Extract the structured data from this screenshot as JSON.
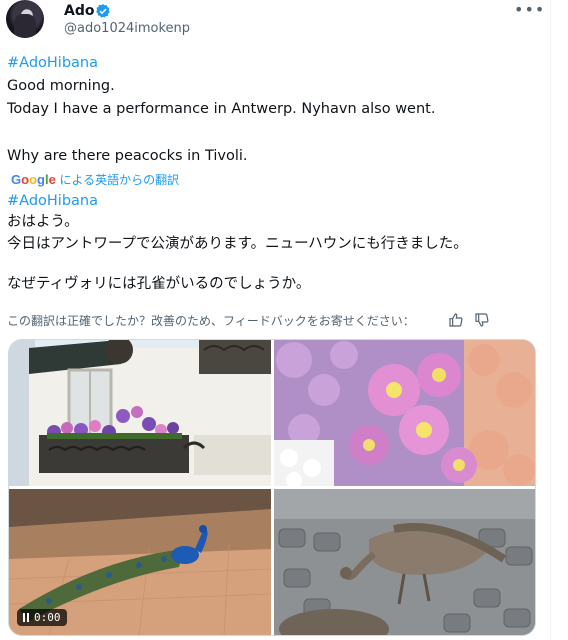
{
  "user": {
    "name": "Ado",
    "handle": "@ado1024imokenp"
  },
  "post": {
    "hashtag_en": "#AdoHibana",
    "line1": "Good morning.",
    "line2": "Today I have a performance in Antwerp. Nyhavn also went.",
    "line3": "Why are there peacocks in Tivoli.",
    "translated_by": "による英語からの翻訳",
    "google": "Google",
    "hashtag_ja": "#AdoHibana",
    "ja1": "おはよう。",
    "ja2": "今日はアントワープで公演があります。ニューハウンにも行きました。",
    "ja3": "なぜティヴォリには孔雀がいるのでしょうか。",
    "feedback": "この翻訳は正確でしたか？改善のため、フィードバックをお寄せください："
  },
  "media": {
    "video_time": "0:00"
  },
  "colors": {
    "accent": "#1d9bf0",
    "muted": "#536471"
  },
  "icons": [
    "verified-badge-icon",
    "more-icon",
    "google-logo-icon",
    "thumbs-up-icon",
    "thumbs-down-icon",
    "pause-icon"
  ]
}
